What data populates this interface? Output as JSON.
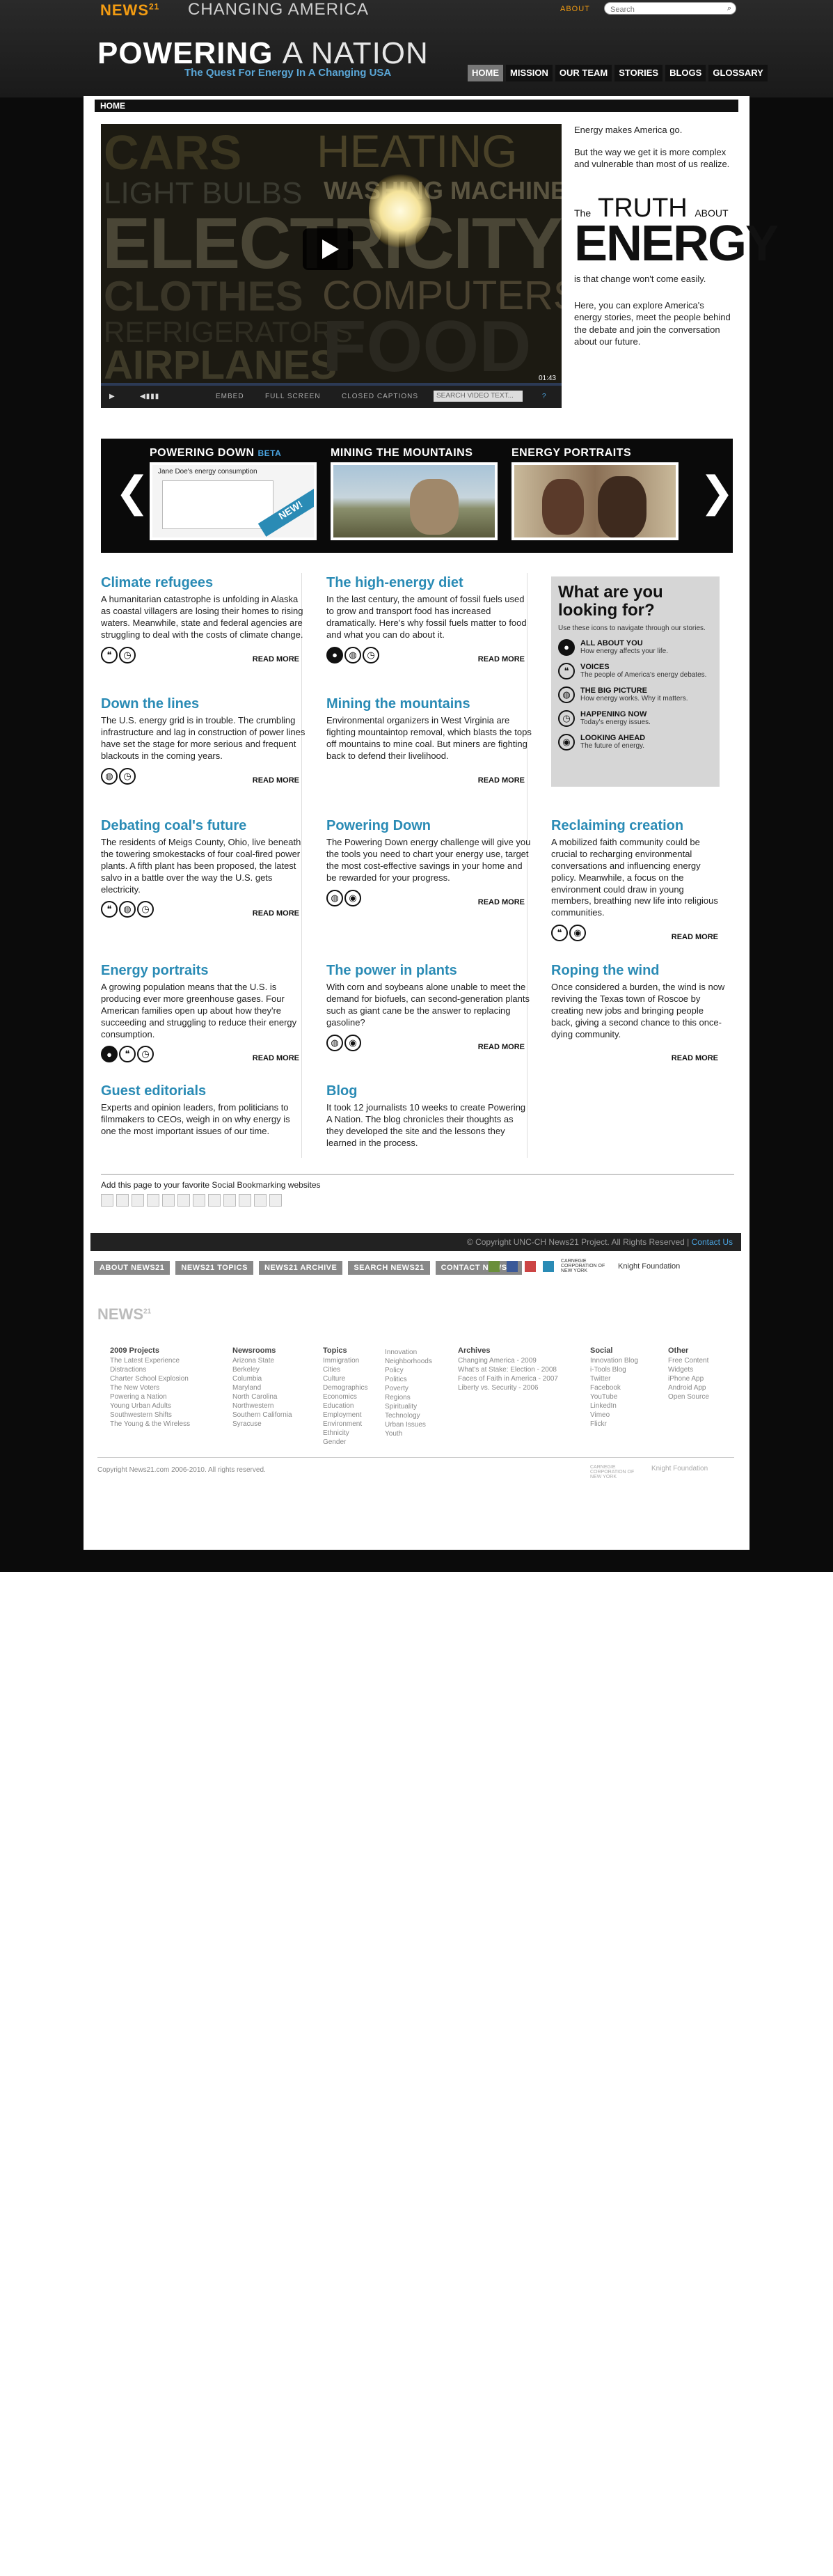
{
  "site": {
    "brand": "NEWS",
    "brand_sup": "21",
    "tagline": "CHANGING AMERICA",
    "about": "ABOUT",
    "search_placeholder": "Search"
  },
  "header": {
    "title_bold": "POWERING",
    "title_thin": "A NATION",
    "subtitle": "The Quest For Energy In A Changing USA",
    "nav": [
      "HOME",
      "MISSION",
      "OUR TEAM",
      "STORIES",
      "BLOGS",
      "GLOSSARY"
    ]
  },
  "breadcrumb": "HOME",
  "video": {
    "words": [
      "CARS",
      "HEATING",
      "LIGHT BULBS",
      "WASHING MACHINES",
      "ELECTRICITY",
      "CLOTHES",
      "COMPUTERS",
      "REFRIGERATORS",
      "AIRPLANES",
      "FOOD"
    ],
    "controls": {
      "embed": "EMBED",
      "fullscreen": "FULL SCREEN",
      "captions": "CLOSED CAPTIONS",
      "search": "SEARCH VIDEO TEXT...",
      "time": "01:43"
    }
  },
  "intro": {
    "p1": "Energy makes America go.",
    "p2": "But the way we get it is more complex and vulnerable than most of us realize.",
    "truth_the": "The",
    "truth_word": "TRUTH",
    "truth_about": "ABOUT",
    "energy": "ENERGY",
    "p3": "is that change won't come easily.",
    "p4": "Here, you can explore America's energy stories, meet the people behind the debate and join the conversation about our future."
  },
  "carousel": {
    "slides": [
      {
        "title": "POWERING DOWN",
        "beta": "BETA",
        "caption": "Jane Doe's energy consumption",
        "badge": "NEW!"
      },
      {
        "title": "MINING THE MOUNTAINS"
      },
      {
        "title": "ENERGY PORTRAITS"
      }
    ]
  },
  "read_more": "READ MORE",
  "stories": {
    "climate": {
      "title": "Climate refugees",
      "body": "A humanitarian catastrophe is unfolding in Alaska as coastal villagers are losing their homes to rising waters. Meanwhile, state and federal agencies are struggling to deal with the costs of climate change."
    },
    "diet": {
      "title": "The high-energy diet",
      "body": "In the last century, the amount of fossil fuels used to grow and transport food has increased dramatically. Here's why fossil fuels matter to food and what you can do about it."
    },
    "lines": {
      "title": "Down the lines",
      "body": "The U.S. energy grid is in trouble. The crumbling infrastructure and lag in construction of power lines have set the stage for more serious and frequent blackouts in the coming years."
    },
    "mining": {
      "title": "Mining the mountains",
      "body": "Environmental organizers in West Virginia are fighting mountaintop removal, which blasts the tops off mountains to mine coal. But miners are fighting back to defend their livelihood."
    },
    "coal": {
      "title": "Debating coal's future",
      "body": "The residents of Meigs County, Ohio, live beneath the towering smokestacks of four coal-fired power plants. A fifth plant has been proposed, the latest salvo in a battle over the way the U.S. gets electricity."
    },
    "powering": {
      "title": "Powering Down",
      "body": "The Powering Down energy challenge will give you the tools you need to chart your energy use, target the most cost-effective savings in your home and be rewarded for your progress."
    },
    "reclaiming": {
      "title": "Reclaiming creation",
      "body": "A mobilized faith community could be crucial to recharging environmental conversations and influencing energy policy. Meanwhile, a focus on the environment could draw in young members, breathing new life into religious communities."
    },
    "portraits": {
      "title": "Energy portraits",
      "body": "A growing population means that the U.S. is producing ever more greenhouse gases. Four American families open up about how they're succeeding and struggling to reduce their energy consumption."
    },
    "plants": {
      "title": "The power in plants",
      "body": "With corn and soybeans alone unable to meet the demand for biofuels, can second-generation plants such as giant cane be the answer to replacing gasoline?"
    },
    "wind": {
      "title": "Roping the wind",
      "body": "Once considered a burden, the wind is now reviving the Texas town of Roscoe by creating new jobs and bringing people back, giving a second chance to this once-dying community."
    },
    "editorials": {
      "title": "Guest editorials",
      "body": "Experts and opinion leaders, from politicians to filmmakers to CEOs, weigh in on why energy is one the most important issues of our time."
    },
    "blog": {
      "title": "Blog",
      "body": "It took 12 journalists 10 weeks to create Powering A Nation. The blog chronicles their thoughts as they developed the site and the lessons they learned in the process."
    }
  },
  "lookbox": {
    "title": "What are you looking for?",
    "subtitle": "Use these icons to navigate through our stories.",
    "items": [
      {
        "label": "ALL ABOUT YOU",
        "desc": "How energy affects your life."
      },
      {
        "label": "VOICES",
        "desc": "The people of America's energy debates."
      },
      {
        "label": "THE BIG PICTURE",
        "desc": "How energy works. Why it matters."
      },
      {
        "label": "HAPPENING NOW",
        "desc": "Today's energy issues."
      },
      {
        "label": "LOOKING AHEAD",
        "desc": "The future of energy."
      }
    ]
  },
  "social": {
    "text": "Add this page to your favorite Social Bookmarking websites"
  },
  "footer": {
    "copyright_bar": "© Copyright UNC-CH News21 Project. All Rights Reserved |",
    "contact": "Contact Us",
    "buttons": [
      "ABOUT NEWS21",
      "NEWS21 TOPICS",
      "NEWS21 ARCHIVE",
      "SEARCH NEWS21",
      "CONTACT NEWS21"
    ],
    "partner_carnegie": "CARNEGIE CORPORATION OF NEW YORK",
    "partner_knight": "Knight Foundation",
    "columns": [
      {
        "head": "2009 Projects",
        "items": [
          "The Latest Experience",
          "Distractions",
          "Charter School Explosion",
          "The New Voters",
          "Powering a Nation",
          "Young Urban Adults",
          "Southwestern Shifts",
          "The Young & the Wireless"
        ]
      },
      {
        "head": "Newsrooms",
        "items": [
          "Arizona State",
          "Berkeley",
          "Columbia",
          "Maryland",
          "North Carolina",
          "Northwestern",
          "Southern California",
          "Syracuse"
        ]
      },
      {
        "head": "Topics",
        "items": [
          "Immigration",
          "Cities",
          "Culture",
          "Demographics",
          "Economics",
          "Education",
          "Employment",
          "Environment",
          "Ethnicity",
          "Gender"
        ]
      },
      {
        "head": "",
        "items": [
          "Innovation",
          "Neighborhoods",
          "Policy",
          "Politics",
          "Poverty",
          "Regions",
          "Spirituality",
          "Technology",
          "Urban Issues",
          "Youth"
        ]
      },
      {
        "head": "Archives",
        "items": [
          "Changing America - 2009",
          "What's at Stake: Election - 2008",
          "Faces of Faith in America - 2007",
          "Liberty vs. Security - 2006"
        ]
      },
      {
        "head": "Social",
        "items": [
          "Innovation Blog",
          "i-Tools Blog",
          "Twitter",
          "Facebook",
          "YouTube",
          "LinkedIn",
          "Vimeo",
          "Flickr"
        ]
      },
      {
        "head": "Other",
        "items": [
          "Free Content",
          "Widgets",
          "iPhone App",
          "Android App",
          "Open Source"
        ]
      }
    ],
    "copy": "Copyright News21.com 2006-2010. All rights reserved."
  }
}
